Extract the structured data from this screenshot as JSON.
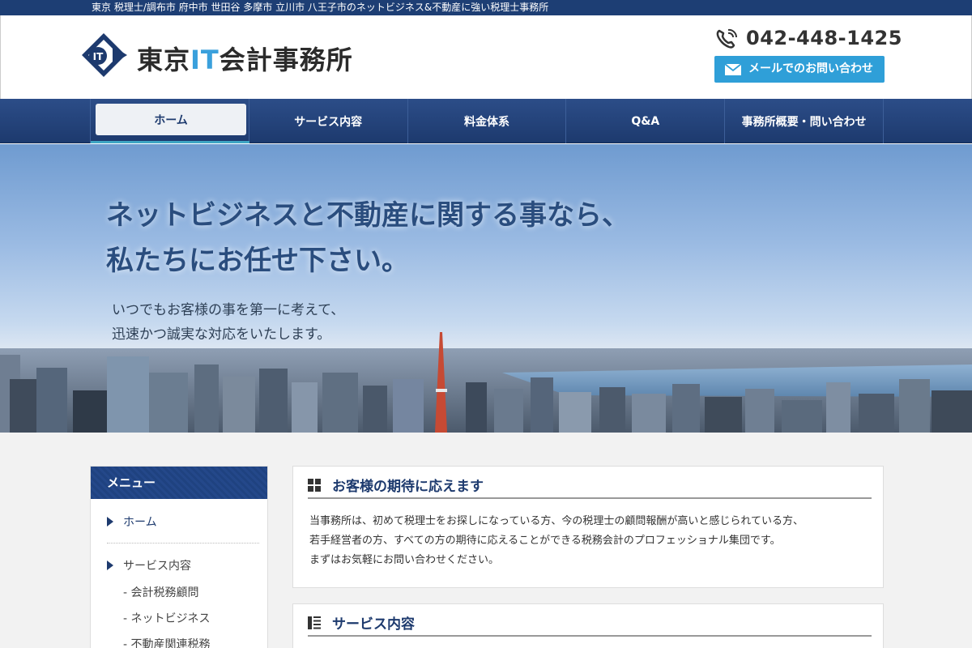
{
  "topbar": {
    "text": "東京 税理士/調布市 府中市 世田谷 多摩市 立川市 八王子市のネットビジネス&不動産に強い税理士事務所"
  },
  "header": {
    "logo_prefix": "東京",
    "logo_it": "IT",
    "logo_suffix": "会計事務所",
    "phone": "042-448-1425",
    "mail_button": "メールでのお問い合わせ"
  },
  "nav": {
    "items": [
      {
        "label": "ホーム"
      },
      {
        "label": "サービス内容"
      },
      {
        "label": "料金体系"
      },
      {
        "label": "Q&A"
      },
      {
        "label": "事務所概要・問い合わせ"
      }
    ]
  },
  "hero": {
    "title_line1": "ネットビジネスと不動産に関する事なら、",
    "title_line2": "私たちにお任せ下さい。",
    "sub_line1": "いつでもお客様の事を第一に考えて、",
    "sub_line2": "迅速かつ誠実な対応をいたします。"
  },
  "sidebar": {
    "heading": "メニュー",
    "items": [
      {
        "label": "ホーム"
      },
      {
        "label": "サービス内容"
      }
    ],
    "subitems": [
      {
        "label": "- 会計税務顧問"
      },
      {
        "label": "- ネットビジネス"
      },
      {
        "label": "- 不動産関連税務"
      }
    ]
  },
  "sections": [
    {
      "title": "お客様の期待に応えます",
      "lines": [
        "当事務所は、初めて税理士をお探しになっている方、今の税理士の顧問報酬が高いと感じられている方、",
        "若手経営者の方、すべての方の期待に応えることができる税務会計のプロフェッショナル集団です。",
        "まずはお気軽にお問い合わせください。"
      ]
    },
    {
      "title": "サービス内容"
    }
  ],
  "colors": {
    "brand_navy": "#1d3a6e",
    "accent_blue": "#2f9fd8",
    "logo_it": "#3aa0dc"
  }
}
